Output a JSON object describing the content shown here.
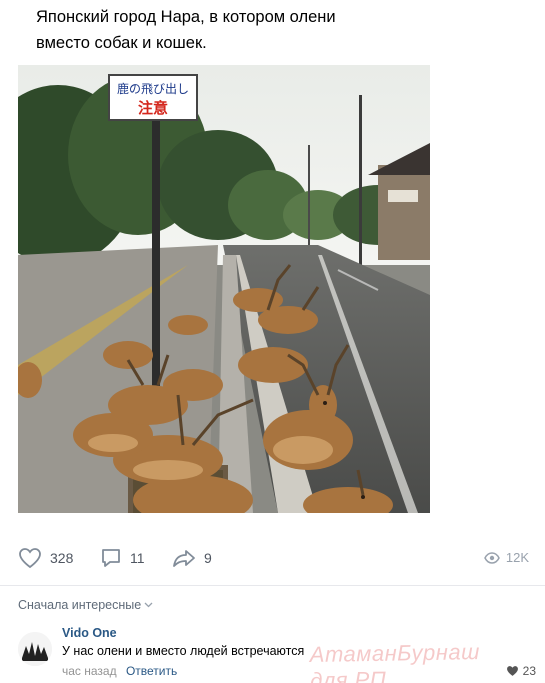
{
  "post": {
    "text_line1": "Японский город Нара, в котором олени",
    "text_line2": "вместо собак и кошек."
  },
  "photo": {
    "sign_line1": "鹿の飛び出し",
    "sign_line2": "注意"
  },
  "actions": {
    "likes": "328",
    "comments": "11",
    "shares": "9",
    "views": "12K"
  },
  "comments_section": {
    "sort_label": "Сначала интересные",
    "items": [
      {
        "author": "Vido One",
        "text": "У нас олени и вместо людей встречаются",
        "time": "час назад",
        "reply_label": "Ответить",
        "likes": "23"
      }
    ]
  },
  "watermark": "АтаманБурнаш для.РП",
  "colors": {
    "link": "#2a5885",
    "action_icon": "#818c99",
    "sign_red": "#d4271d"
  }
}
